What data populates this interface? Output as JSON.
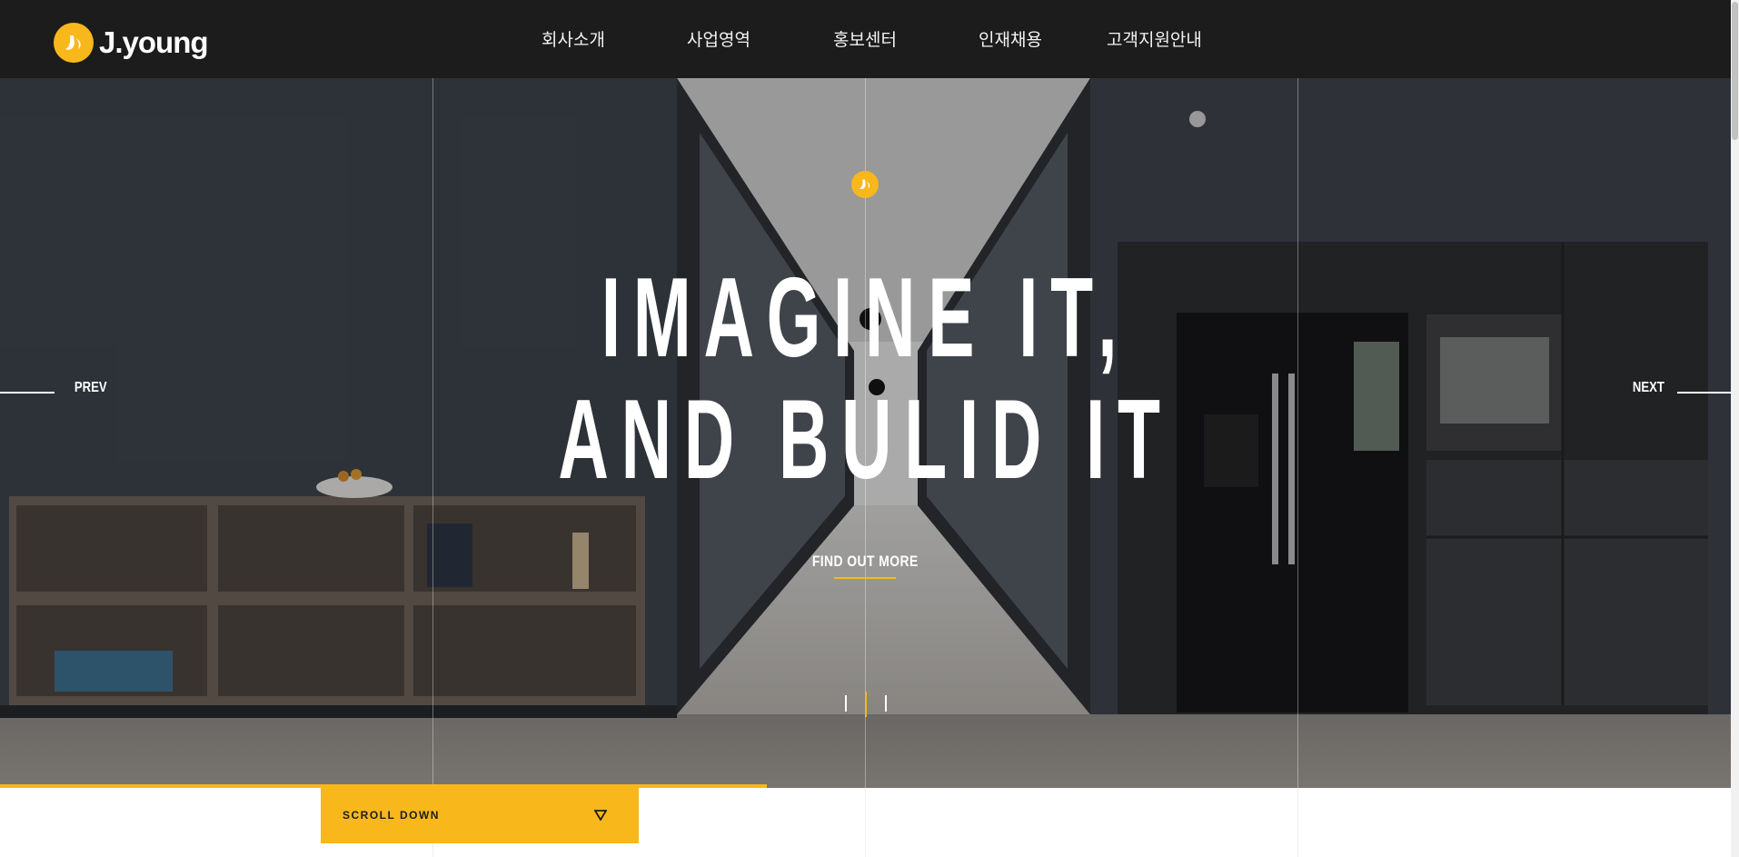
{
  "brand": {
    "name": "J.young",
    "accent": "#f8b81c",
    "header_bg": "#1b1c1b"
  },
  "nav": {
    "items": [
      {
        "label": "회사소개"
      },
      {
        "label": "사업영역"
      },
      {
        "label": "홍보센터"
      },
      {
        "label": "인재채용"
      },
      {
        "label": "고객지원안내"
      }
    ]
  },
  "hero": {
    "badge_icon": "logo-mark-icon",
    "headline_line1": "IMAGINE IT,",
    "headline_line2": "AND BULID IT",
    "cta_label": "FIND OUT MORE",
    "prev_label": "PREV",
    "next_label": "NEXT",
    "slide_count": 3,
    "active_slide": 2,
    "progress_fraction": 0.443
  },
  "scroll": {
    "label": "SCROLL DOWN",
    "icon": "triangle-down-icon"
  }
}
